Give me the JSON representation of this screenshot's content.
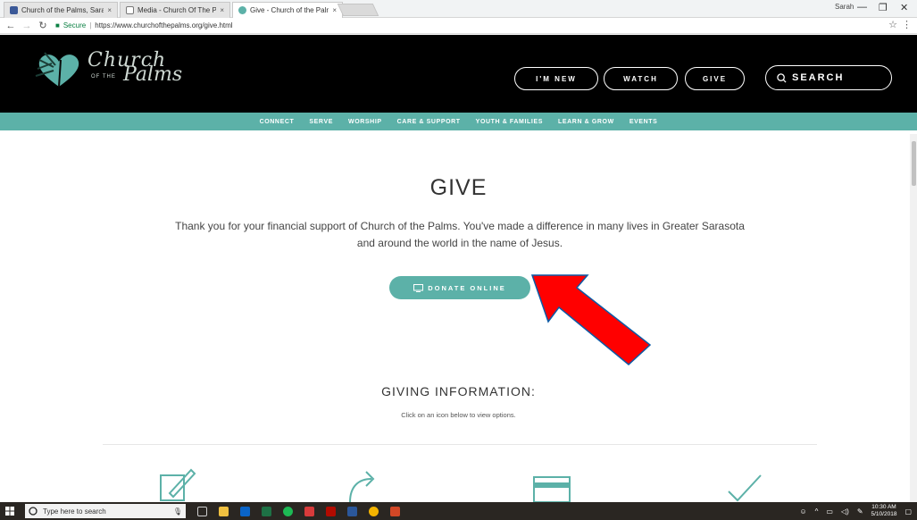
{
  "browser": {
    "tabs": [
      {
        "label": "Church of the Palms, Sara",
        "close": "×"
      },
      {
        "label": "Media - Church Of The P",
        "close": "×"
      },
      {
        "label": "Give - Church of the Palm",
        "close": "×"
      }
    ],
    "user": "Sarah",
    "window_controls": {
      "minimize": "—",
      "maximize": "❐",
      "close": "✕"
    },
    "secure_label": "Secure",
    "url": "https://www.churchofthepalms.org/give.html"
  },
  "site": {
    "logo": {
      "line1": "Church",
      "small": "OF THE",
      "line2": "Palms"
    },
    "header_buttons": [
      "I'M NEW",
      "WATCH",
      "GIVE"
    ],
    "search_label": "SEARCH",
    "nav": [
      "CONNECT",
      "SERVE",
      "WORSHIP",
      "CARE & SUPPORT",
      "YOUTH & FAMILIES",
      "LEARN & GROW",
      "EVENTS"
    ]
  },
  "main": {
    "title": "GIVE",
    "intro_line1": "Thank you for your financial support of Church of the Palms. You've made a difference in many lives in Greater Sarasota",
    "intro_line2": "and around the world in the name of Jesus.",
    "donate_label": "DONATE ONLINE",
    "giving_title": "GIVING INFORMATION:",
    "giving_subtitle": "Click on an icon below to view options."
  },
  "taskbar": {
    "search_placeholder": "Type here to search",
    "time": "10:30 AM",
    "date": "5/10/2018"
  },
  "colors": {
    "teal": "#5cb1a8",
    "arrow": "#ff0000",
    "header_bg": "#000000"
  }
}
